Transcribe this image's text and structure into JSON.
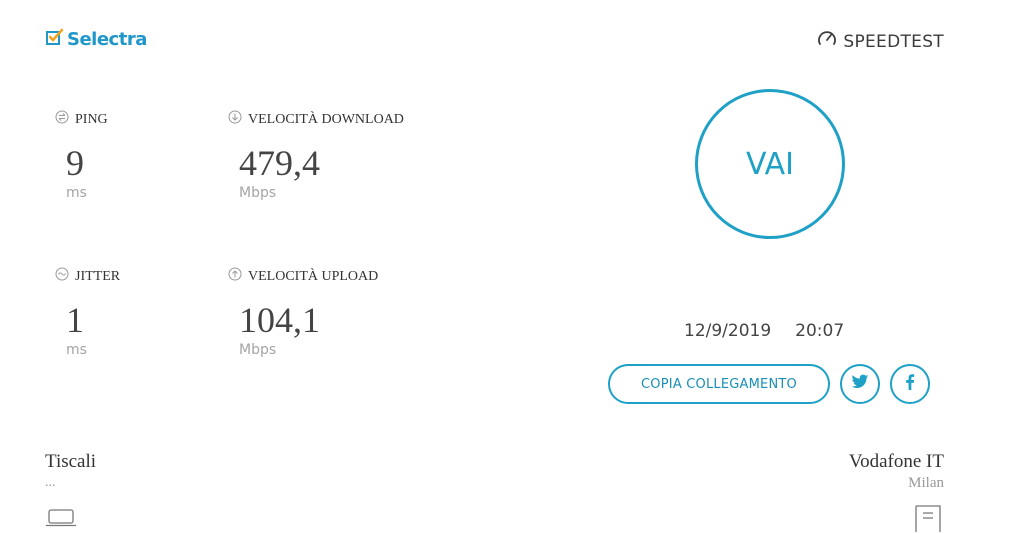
{
  "brand": {
    "logo_text": "Selectra",
    "speedtest_text": "SPEEDTEST",
    "accent_color": "#1ea0c7"
  },
  "metrics": {
    "ping": {
      "label": "PING",
      "value": "9",
      "unit": "ms",
      "icon": "ping-icon"
    },
    "download": {
      "label": "VELOCITÀ DOWNLOAD",
      "value": "479,4",
      "unit": "Mbps",
      "icon": "download-icon"
    },
    "jitter": {
      "label": "JITTER",
      "value": "1",
      "unit": "ms",
      "icon": "jitter-icon"
    },
    "upload": {
      "label": "VELOCITÀ UPLOAD",
      "value": "104,1",
      "unit": "Mbps",
      "icon": "upload-icon"
    }
  },
  "go_button": {
    "label": "VAI"
  },
  "result": {
    "date": "12/9/2019",
    "time": "20:07"
  },
  "share": {
    "copy_label": "COPIA COLLEGAMENTO",
    "twitter_icon": "twitter-icon",
    "facebook_icon": "facebook-icon"
  },
  "isp": {
    "name": "Tiscali",
    "sub": "...",
    "icon": "laptop-icon"
  },
  "server": {
    "name": "Vodafone IT",
    "location": "Milan",
    "icon": "server-icon"
  }
}
